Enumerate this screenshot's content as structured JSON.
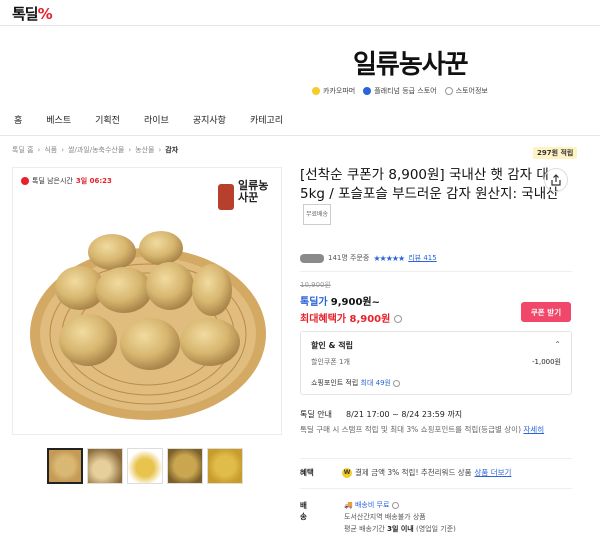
{
  "header": {
    "logo_text": "톡딜",
    "logo_mark": "%"
  },
  "store": {
    "name": "일류농사꾼",
    "links": [
      {
        "label": "카카오파머",
        "color": "#f6cc28"
      },
      {
        "label": "플래티넘 등급 스토어",
        "color": "#2a64d8"
      },
      {
        "label": "스토어정보",
        "color": "#999999"
      }
    ]
  },
  "nav": {
    "items": [
      "홈",
      "베스트",
      "기획전",
      "라이브",
      "공지사항",
      "카테고리"
    ]
  },
  "breadcrumb": {
    "items": [
      "톡딜 홈",
      "식품",
      "쌀/과일/농축수산물",
      "농산물"
    ],
    "current": "감자"
  },
  "points_badge": "297원 적립",
  "image_card": {
    "timer_label": "톡딜 남은시간",
    "timer_value": "3일 06:23",
    "stamp_text": "일류농사꾼"
  },
  "product": {
    "title": "[선착순 쿠폰가 8,900원] 국내산 햇 감자 대 5kg / 포슬포슬 부드러운 감자 원산지: 국내산",
    "tag": "무료배송",
    "orders": "141명 주문중",
    "stars": "★★★★★",
    "review_label": "리뷰 415"
  },
  "price": {
    "original": "10,900원",
    "deal_label": "톡딜가",
    "deal_value": "9,900원~",
    "max_label": "최대혜택가",
    "max_value": "8,900원",
    "coupon_button": "쿠폰 받기"
  },
  "discount": {
    "header": "할인 & 적립",
    "coupon_label": "할인쿠폰 1개",
    "coupon_value": "-1,000원",
    "points_label": "쇼핑포인트 적립",
    "points_max": "최대 49원"
  },
  "deal_info": {
    "label": "톡딜 안내",
    "period": "8/21 17:00 ~ 8/24 23:59 까지",
    "note": "톡딜 구매 시 스탬프 적립 및 최대 3% 쇼핑포인트를 적립(등급별 상이)",
    "more": "자세히"
  },
  "benefit": {
    "label": "혜택",
    "badge": "W",
    "text": "결제 금액 3% 적립! 추천리워드 상품",
    "more": "상품 더보기"
  },
  "shipping": {
    "label": "배송",
    "free": "배송비 무료",
    "region": "도서산간지역 배송불가 상품",
    "avg_prefix": "평균 배송기간",
    "avg_days": "3일 이내",
    "avg_suffix": "(영업일 기준)"
  }
}
